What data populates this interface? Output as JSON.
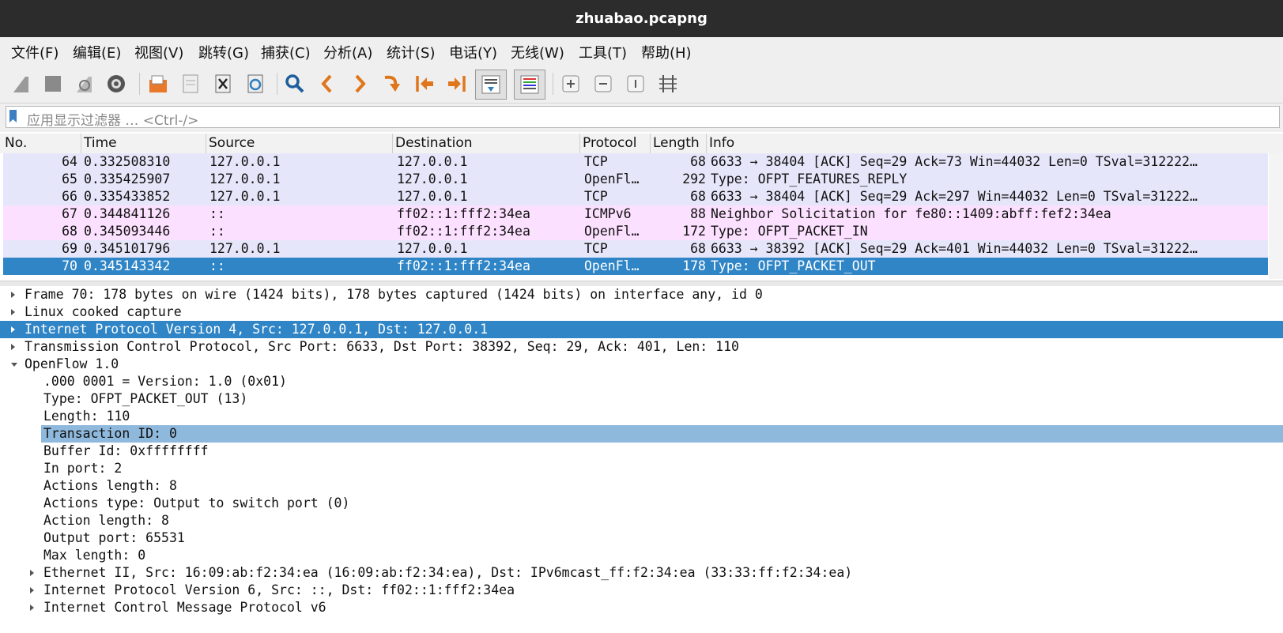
{
  "window": {
    "title": "zhuabao.pcapng"
  },
  "menu": [
    "文件(F)",
    "编辑(E)",
    "视图(V)",
    "跳转(G)",
    "捕获(C)",
    "分析(A)",
    "统计(S)",
    "电话(Y)",
    "无线(W)",
    "工具(T)",
    "帮助(H)"
  ],
  "toolbar": {
    "icons": [
      "start-capture-icon",
      "stop-capture-icon",
      "restart-capture-icon",
      "capture-options-icon",
      "open-file-icon",
      "save-file-icon",
      "close-file-icon",
      "reload-file-icon",
      "find-packet-icon",
      "go-back-icon",
      "go-forward-icon",
      "go-to-packet-icon",
      "first-packet-icon",
      "last-packet-icon",
      "auto-scroll-icon",
      "colorize-icon",
      "zoom-in-icon",
      "zoom-out-icon",
      "normal-size-icon",
      "resize-columns-icon"
    ]
  },
  "filter": {
    "placeholder": "应用显示过滤器 … <Ctrl-/>"
  },
  "columns": {
    "no": "No.",
    "time": "Time",
    "source": "Source",
    "destination": "Destination",
    "protocol": "Protocol",
    "length": "Length",
    "info": "Info"
  },
  "packets": [
    {
      "no": "64",
      "time": "0.332508310",
      "src": "127.0.0.1",
      "dst": "127.0.0.1",
      "proto": "TCP",
      "len": "68",
      "info": "6633 → 38404 [ACK] Seq=29 Ack=73 Win=44032 Len=0 TSval=312222…",
      "style": "tcp"
    },
    {
      "no": "65",
      "time": "0.335425907",
      "src": "127.0.0.1",
      "dst": "127.0.0.1",
      "proto": "OpenFl…",
      "len": "292",
      "info": "Type: OFPT_FEATURES_REPLY",
      "style": "tcp"
    },
    {
      "no": "66",
      "time": "0.335433852",
      "src": "127.0.0.1",
      "dst": "127.0.0.1",
      "proto": "TCP",
      "len": "68",
      "info": "6633 → 38404 [ACK] Seq=29 Ack=297 Win=44032 Len=0 TSval=31222…",
      "style": "tcp"
    },
    {
      "no": "67",
      "time": "0.344841126",
      "src": "::",
      "dst": "ff02::1:fff2:34ea",
      "proto": "ICMPv6",
      "len": "88",
      "info": "Neighbor Solicitation for fe80::1409:abff:fef2:34ea",
      "style": "ipv6"
    },
    {
      "no": "68",
      "time": "0.345093446",
      "src": "::",
      "dst": "ff02::1:fff2:34ea",
      "proto": "OpenFl…",
      "len": "172",
      "info": "Type: OFPT_PACKET_IN",
      "style": "ipv6"
    },
    {
      "no": "69",
      "time": "0.345101796",
      "src": "127.0.0.1",
      "dst": "127.0.0.1",
      "proto": "TCP",
      "len": "68",
      "info": "6633 → 38392 [ACK] Seq=29 Ack=401 Win=44032 Len=0 TSval=31222…",
      "style": "tcp"
    },
    {
      "no": "70",
      "time": "0.345143342",
      "src": "::",
      "dst": "ff02::1:fff2:34ea",
      "proto": "OpenFl…",
      "len": "178",
      "info": "Type: OFPT_PACKET_OUT",
      "style": "sel"
    }
  ],
  "details": [
    {
      "text": "Frame 70: 178 bytes on wire (1424 bits), 178 bytes captured (1424 bits) on interface any, id 0",
      "expander": "right",
      "indent": 0,
      "style": ""
    },
    {
      "text": "Linux cooked capture",
      "expander": "right",
      "indent": 0,
      "style": ""
    },
    {
      "text": "Internet Protocol Version 4, Src: 127.0.0.1, Dst: 127.0.0.1",
      "expander": "right",
      "indent": 0,
      "style": "sel"
    },
    {
      "text": "Transmission Control Protocol, Src Port: 6633, Dst Port: 38392, Seq: 29, Ack: 401, Len: 110",
      "expander": "right",
      "indent": 0,
      "style": ""
    },
    {
      "text": "OpenFlow 1.0",
      "expander": "down",
      "indent": 0,
      "style": ""
    },
    {
      "text": ".000 0001 = Version: 1.0 (0x01)",
      "expander": "",
      "indent": 1,
      "style": ""
    },
    {
      "text": "Type: OFPT_PACKET_OUT (13)",
      "expander": "",
      "indent": 1,
      "style": ""
    },
    {
      "text": "Length: 110",
      "expander": "",
      "indent": 1,
      "style": ""
    },
    {
      "text": "Transaction ID: 0",
      "expander": "",
      "indent": 1,
      "style": "field-sel"
    },
    {
      "text": "Buffer Id: 0xffffffff",
      "expander": "",
      "indent": 1,
      "style": ""
    },
    {
      "text": "In port: 2",
      "expander": "",
      "indent": 1,
      "style": ""
    },
    {
      "text": "Actions length: 8",
      "expander": "",
      "indent": 1,
      "style": ""
    },
    {
      "text": "Actions type: Output to switch port (0)",
      "expander": "",
      "indent": 1,
      "style": ""
    },
    {
      "text": "Action length: 8",
      "expander": "",
      "indent": 1,
      "style": ""
    },
    {
      "text": "Output port: 65531",
      "expander": "",
      "indent": 1,
      "style": ""
    },
    {
      "text": "Max length: 0",
      "expander": "",
      "indent": 1,
      "style": ""
    },
    {
      "text": "Ethernet II, Src: 16:09:ab:f2:34:ea (16:09:ab:f2:34:ea), Dst: IPv6mcast_ff:f2:34:ea (33:33:ff:f2:34:ea)",
      "expander": "right",
      "indent": 1,
      "style": ""
    },
    {
      "text": "Internet Protocol Version 6, Src: ::, Dst: ff02::1:fff2:34ea",
      "expander": "right",
      "indent": 1,
      "style": ""
    },
    {
      "text": "Internet Control Message Protocol v6",
      "expander": "right",
      "indent": 1,
      "style": ""
    }
  ],
  "colors": {
    "tcp_row": "#e6e6fa",
    "ipv6_row": "#fce0ff",
    "selected": "#2f85c6",
    "field_selected": "#8fb9dc"
  }
}
